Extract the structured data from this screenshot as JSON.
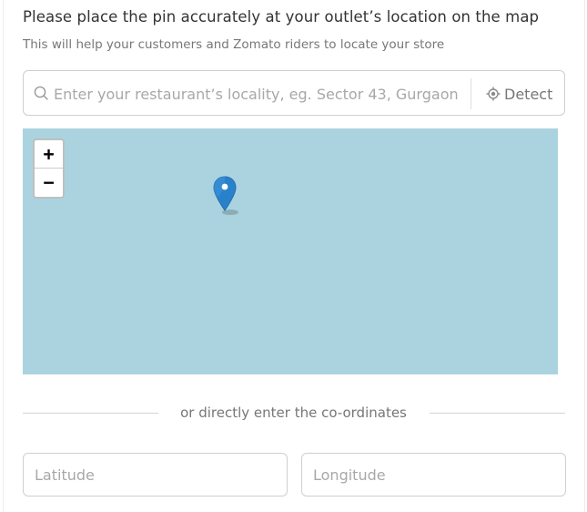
{
  "header": {
    "title": "Please place the pin accurately at your outlet’s location on the map",
    "subtitle": "This will help your customers and Zomato riders to locate your store"
  },
  "search": {
    "placeholder": "Enter your restaurant’s locality, eg. Sector 43, Gurgaon",
    "value": "",
    "icon": "search-icon",
    "detect_label": "Detect",
    "detect_icon": "locate-crosshair-icon"
  },
  "map": {
    "zoom_in_label": "+",
    "zoom_out_label": "−",
    "water_color": "#aad3df",
    "marker_color": "#2a81cb"
  },
  "coordinates": {
    "divider_text": "or directly enter the co-ordinates",
    "latitude_placeholder": "Latitude",
    "longitude_placeholder": "Longitude",
    "latitude_value": "",
    "longitude_value": ""
  }
}
